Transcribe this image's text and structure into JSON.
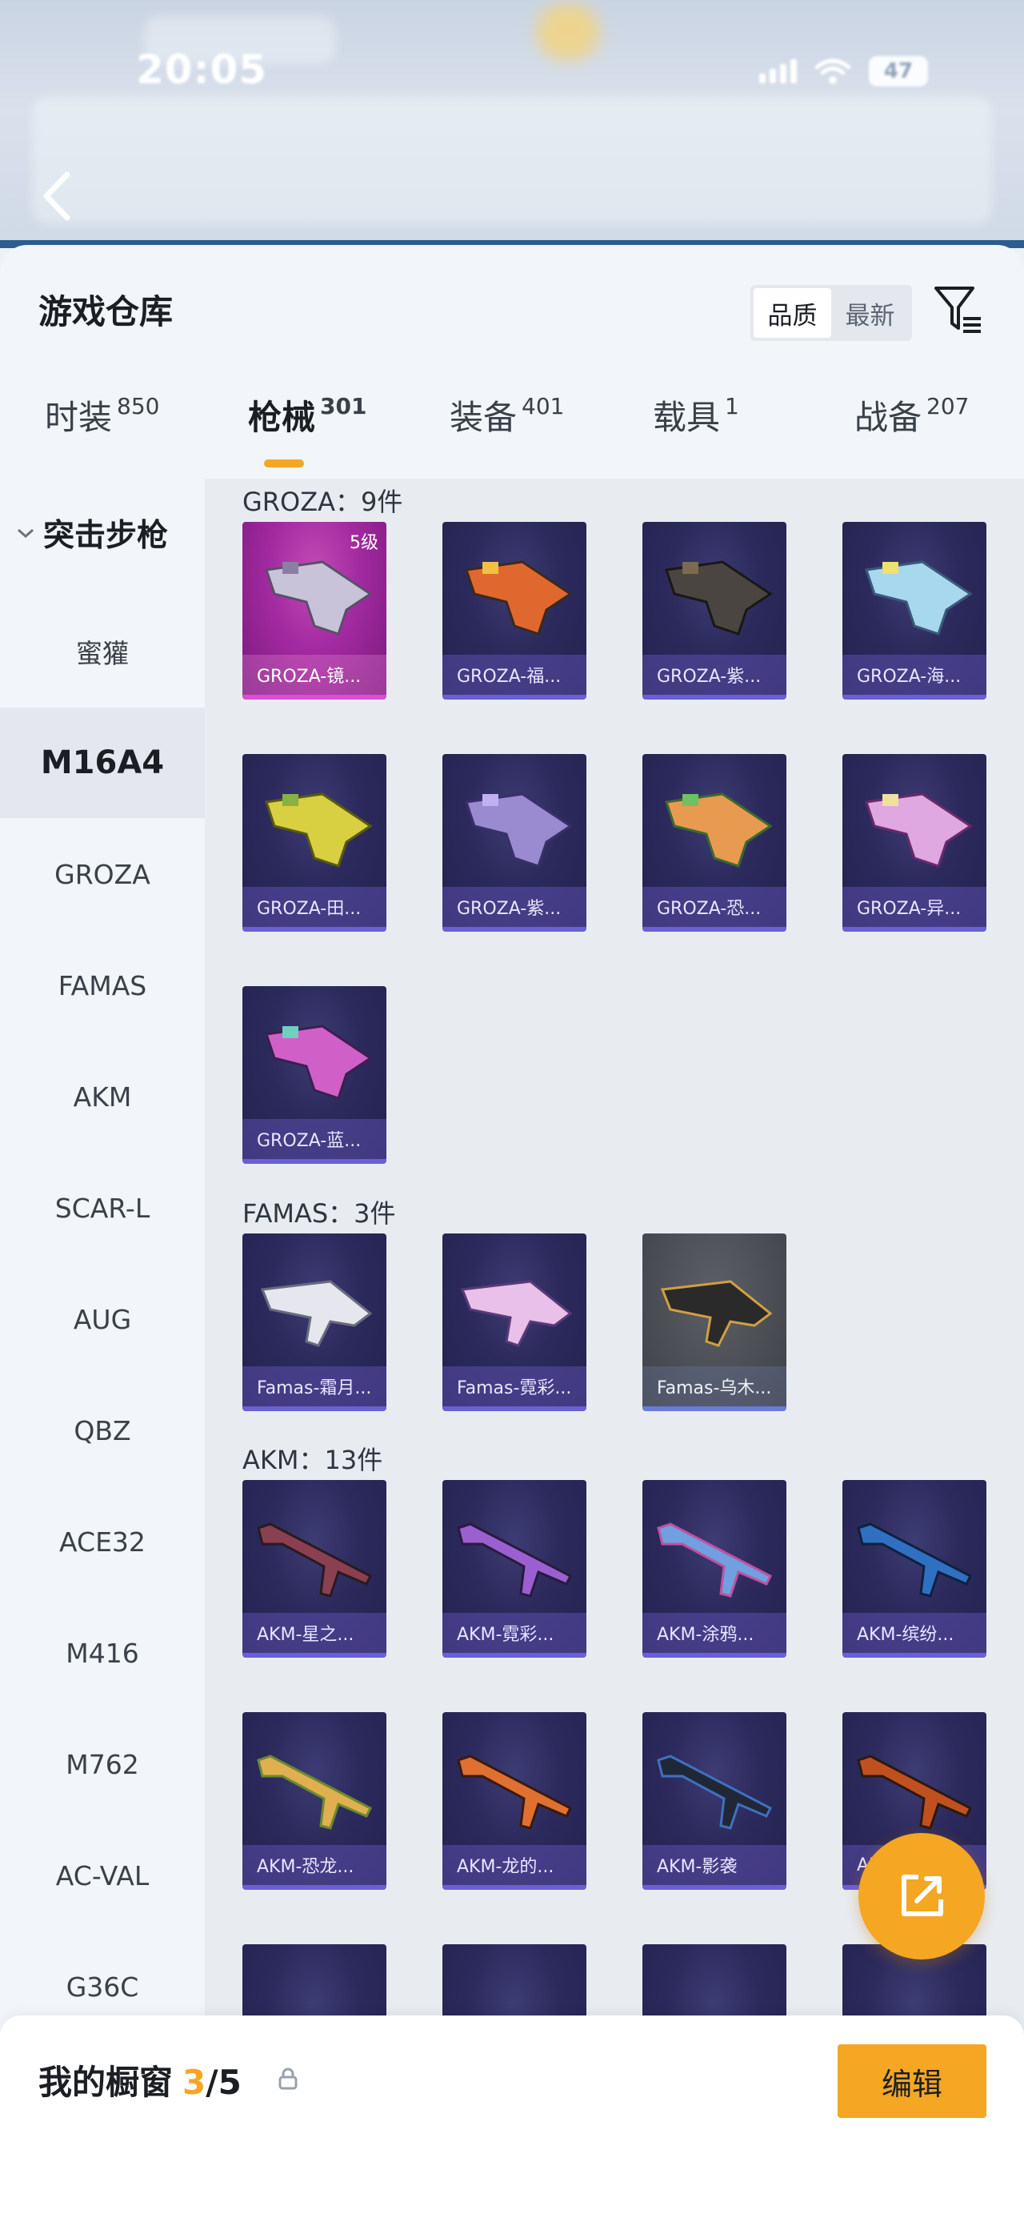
{
  "status_bar": {
    "time": "20:05",
    "battery": "47"
  },
  "sheet": {
    "title": "游戏仓库"
  },
  "sort": {
    "options": [
      "品质",
      "最新"
    ],
    "active": "品质"
  },
  "tabs": [
    {
      "label": "时装",
      "count": "850"
    },
    {
      "label": "枪械",
      "count": "301"
    },
    {
      "label": "装备",
      "count": "401"
    },
    {
      "label": "载具",
      "count": "1"
    },
    {
      "label": "战备",
      "count": "207"
    }
  ],
  "active_tab": "枪械",
  "sidebar": {
    "group": "突击步枪",
    "items": [
      "蜜獾",
      "M16A4",
      "GROZA",
      "FAMAS",
      "AKM",
      "SCAR-L",
      "AUG",
      "QBZ",
      "ACE32",
      "M416",
      "M762",
      "AC-VAL",
      "G36C"
    ],
    "active": "M16A4"
  },
  "sections": [
    {
      "title": "GROZA：9件",
      "items": [
        {
          "name": "GROZA-镜...",
          "badge": "5级"
        },
        {
          "name": "GROZA-福..."
        },
        {
          "name": "GROZA-紫..."
        },
        {
          "name": "GROZA-海..."
        },
        {
          "name": "GROZA-田..."
        },
        {
          "name": "GROZA-紫..."
        },
        {
          "name": "GROZA-恐..."
        },
        {
          "name": "GROZA-异..."
        },
        {
          "name": "GROZA-蓝..."
        }
      ]
    },
    {
      "title": "FAMAS：3件",
      "items": [
        {
          "name": "Famas-霜月..."
        },
        {
          "name": "Famas-霓彩..."
        },
        {
          "name": "Famas-乌木..."
        }
      ]
    },
    {
      "title": "AKM：13件",
      "items": [
        {
          "name": "AKM-星之..."
        },
        {
          "name": "AKM-霓彩..."
        },
        {
          "name": "AKM-涂鸦..."
        },
        {
          "name": "AKM-缤纷..."
        },
        {
          "name": "AKM-恐龙..."
        },
        {
          "name": "AKM-龙的..."
        },
        {
          "name": "AKM-影袭"
        },
        {
          "name": "AKM-..."
        }
      ]
    }
  ],
  "showcase": {
    "label": "我的橱窗",
    "current": "3",
    "total": "/5"
  },
  "edit_button": "编辑",
  "colors": {
    "accent": "#f5a623",
    "card_bg": "#2c2a5c",
    "card_border": "#6a5fd3"
  }
}
